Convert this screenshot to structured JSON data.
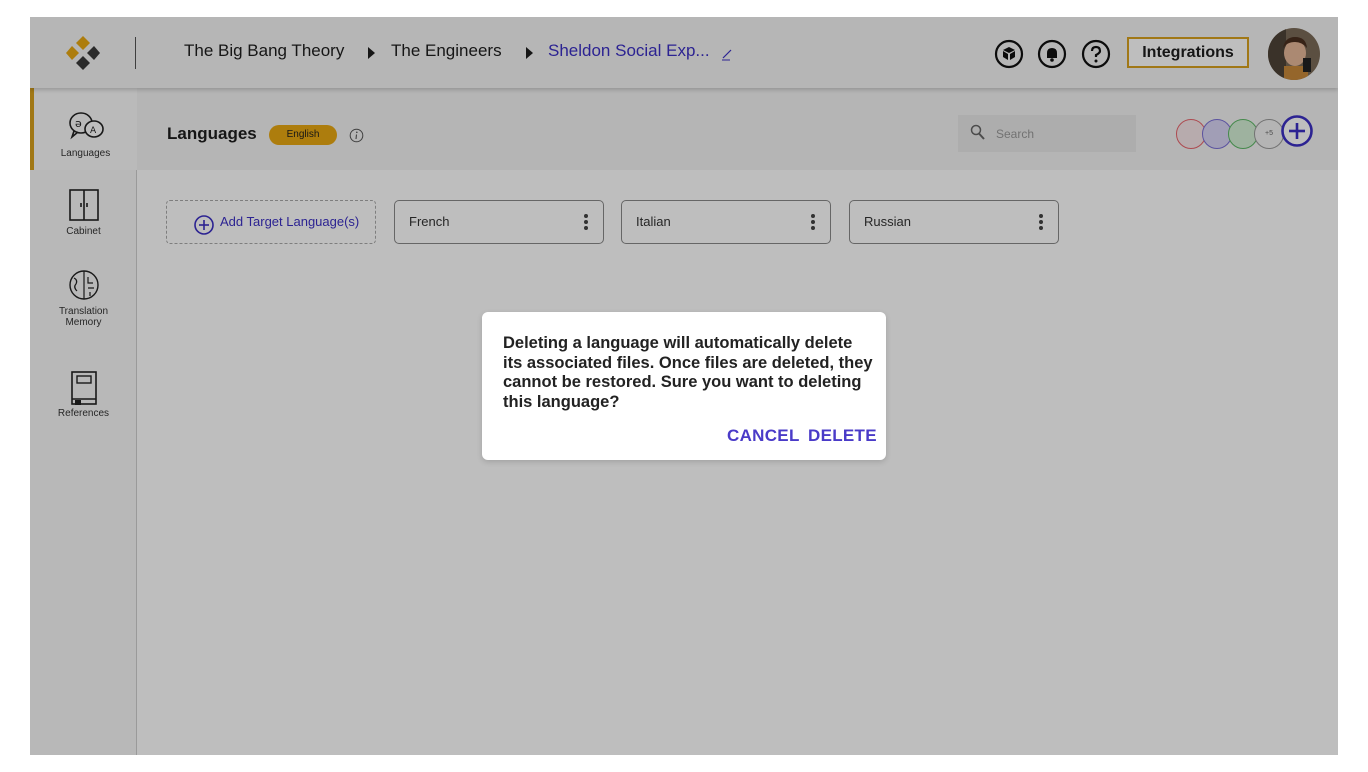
{
  "header": {
    "breadcrumb": [
      "The Big Bang Theory",
      "The Engineers",
      "Sheldon Social Exp..."
    ],
    "integrations_label": "Integrations"
  },
  "sidebar": {
    "items": [
      {
        "label": "Languages",
        "icon": "languages-icon",
        "active": true
      },
      {
        "label": "Cabinet",
        "icon": "cabinet-icon"
      },
      {
        "label": "Translation Memory",
        "icon": "brain-icon"
      },
      {
        "label": "References",
        "icon": "book-icon"
      }
    ]
  },
  "main": {
    "title": "Languages",
    "source_language": "English",
    "search_placeholder": "Search",
    "collaborators_more": "+5",
    "add_language_label": "Add Target Language(s)",
    "target_languages": [
      "French",
      "Italian",
      "Russian"
    ]
  },
  "dialog": {
    "message": "Deleting a language will automatically delete its associated files. Once files are deleted, they cannot be restored. Sure you want to deleting this language?",
    "cancel_label": "CANCEL",
    "delete_label": "DELETE"
  },
  "colors": {
    "accent": "#d9a21e",
    "badge": "#e8a812",
    "link": "#3b2fc4",
    "collaborators": [
      "#e8646c",
      "#7a6fd6",
      "#5cb865",
      "#9a9a9a"
    ]
  }
}
